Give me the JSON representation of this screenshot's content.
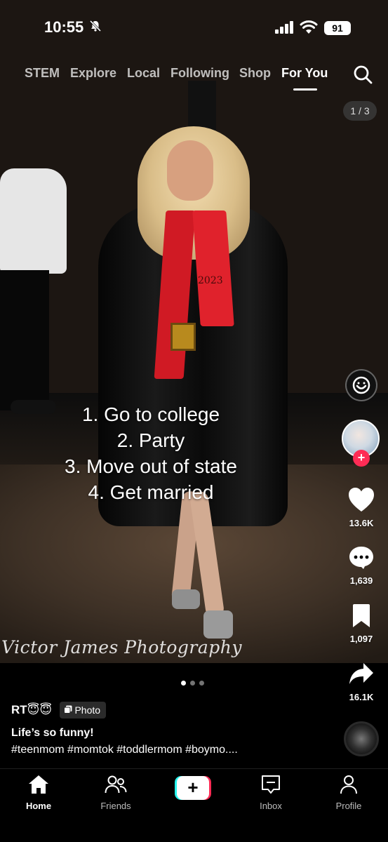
{
  "status_bar": {
    "time": "10:55",
    "battery": "91",
    "icons": [
      "bell-slash-icon",
      "cellular-signal-icon",
      "wifi-icon",
      "battery-icon"
    ]
  },
  "top_nav": {
    "tabs": [
      {
        "label": "STEM"
      },
      {
        "label": "Explore"
      },
      {
        "label": "Local"
      },
      {
        "label": "Following"
      },
      {
        "label": "Shop"
      },
      {
        "label": "For You"
      }
    ],
    "active_tab": "For You",
    "search_icon": "search-icon"
  },
  "post": {
    "page_indicator": "1 / 3",
    "overlay_lines": [
      "1. Go to college",
      "2. Party",
      "3. Move out of state",
      "4. Get married"
    ],
    "photo_stole_text": "2023",
    "watermark": "Victor James Photography",
    "carousel": {
      "total": 3,
      "current": 1
    }
  },
  "actions": {
    "likes": "13.6K",
    "comments": "1,639",
    "saves": "1,097",
    "shares": "16.1K"
  },
  "caption": {
    "username": "RT😇😇",
    "badge_label": "Photo",
    "title": "Life’s so funny!",
    "hashtags": "#teenmom #momtok #toddlermom #boymo...."
  },
  "bottom_nav": {
    "items": [
      {
        "label": "Home"
      },
      {
        "label": "Friends"
      },
      {
        "label": "+"
      },
      {
        "label": "Inbox"
      },
      {
        "label": "Profile"
      }
    ],
    "active": "Home"
  },
  "colors": {
    "accent_red": "#fe2c55",
    "accent_cyan": "#25f4ee",
    "background": "#000000"
  }
}
